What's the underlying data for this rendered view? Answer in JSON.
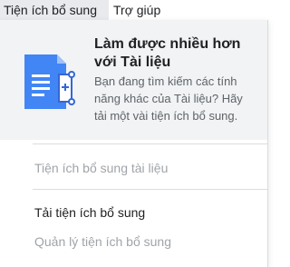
{
  "menubar": {
    "addons_label": "Tiện ích bổ sung",
    "help_label": "Trợ giúp"
  },
  "promo": {
    "icon": "docs-addon-icon",
    "title": "Làm được nhiều hơn với Tài liệu",
    "description": "Bạn đang tìm kiếm các tính năng khác của Tài liệu? Hãy tải một vài tiện ích bổ sung."
  },
  "menu": {
    "docs_addons_label": "Tiện ích bổ sung tài liệu",
    "get_addons_label": "Tải tiện ích bổ sung",
    "manage_addons_label": "Quản lý tiện ích bổ sung"
  },
  "colors": {
    "doc_blue": "#4285f4",
    "doc_dark": "#3367d6",
    "promo_bg": "#f1f3f4",
    "disabled_text": "#a0a4a8"
  }
}
